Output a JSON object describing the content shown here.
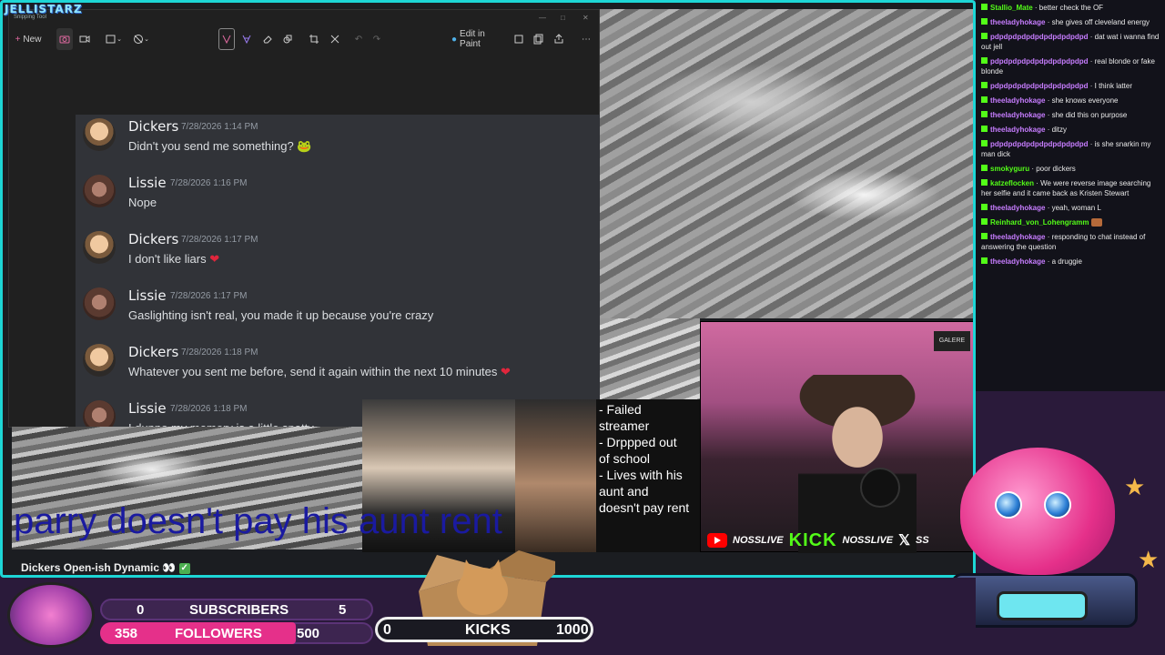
{
  "stream": {
    "logo": "JELLISTARZ",
    "logo_sub": "Snipping Tool",
    "video_title": "Dickers Open-ish Dynamic",
    "video_title_emoji": "👀"
  },
  "snipping_tool": {
    "new_label": "New",
    "edit_label": "Edit in Paint"
  },
  "discord": {
    "messages": [
      {
        "user": "Dickers",
        "time": "7/28/2026 1:14 PM",
        "text": "Didn't you send me something? 🐸"
      },
      {
        "user": "Lissie",
        "time": "7/28/2026 1:16 PM",
        "text": "Nope"
      },
      {
        "user": "Dickers",
        "time": "7/28/2026 1:17 PM",
        "text": "I don't like liars"
      },
      {
        "user": "Lissie",
        "time": "7/28/2026 1:17 PM",
        "text": "Gaslighting isn't real, you made it up because you're crazy"
      },
      {
        "user": "Dickers",
        "time": "7/28/2026 1:18 PM",
        "text": "Whatever you sent me before, send it again within the next 10 minutes"
      },
      {
        "user": "Lissie",
        "time": "7/28/2026 1:18 PM",
        "text": "I dunno my memory is a little spotty"
      }
    ]
  },
  "collage": {
    "caption": "parry doesn't pay his aunt rent",
    "notes": [
      "- Failed",
      "streamer",
      "- Drppped out",
      "of school",
      "- Lives with his",
      "aunt and",
      "doesn't pay rent"
    ]
  },
  "webcam": {
    "sign": "GALERE",
    "youtube_handle": "NOSSLIVE",
    "kick_logo": "KICK",
    "kick_handle": "NOSSLIVE",
    "x_handle": "SS"
  },
  "chat": [
    {
      "user": "Stallio_Mate",
      "color": "#53fc18",
      "text": "better check the OF"
    },
    {
      "user": "theeladyhokage",
      "color": "#c77dff",
      "text": "she gives off cleveland energy"
    },
    {
      "user": "pdpdpdpdpdpdpdpdpdpdpd",
      "color": "#c77dff",
      "text": "dat wat i wanna find out jell"
    },
    {
      "user": "pdpdpdpdpdpdpdpdpdpdpd",
      "color": "#c77dff",
      "text": "real blonde or fake blonde"
    },
    {
      "user": "pdpdpdpdpdpdpdpdpdpdpd",
      "color": "#c77dff",
      "text": "I think latter"
    },
    {
      "user": "theeladyhokage",
      "color": "#c77dff",
      "text": "she knows everyone"
    },
    {
      "user": "theeladyhokage",
      "color": "#c77dff",
      "text": "she did this on purpose"
    },
    {
      "user": "theeladyhokage",
      "color": "#c77dff",
      "text": "ditzy"
    },
    {
      "user": "pdpdpdpdpdpdpdpdpdpdpd",
      "color": "#c77dff",
      "text": "is she snarkin my man dick"
    },
    {
      "user": "smokyguru",
      "color": "#53fc18",
      "text": "poor dickers"
    },
    {
      "user": "katzeflocken",
      "color": "#53fc18",
      "text": "We were reverse image searching her selfie and it came back as Kristen Stewart"
    },
    {
      "user": "theeladyhokage",
      "color": "#c77dff",
      "text": "yeah, woman L"
    },
    {
      "user": "Reinhard_von_Lohengramm",
      "color": "#53fc18",
      "text": ""
    },
    {
      "user": "theeladyhokage",
      "color": "#c77dff",
      "text": "responding to chat instead of answering the question"
    },
    {
      "user": "theeladyhokage",
      "color": "#c77dff",
      "text": "a druggie"
    }
  ],
  "stats": {
    "subscribers": {
      "label": "SUBSCRIBERS",
      "current": "0",
      "goal": "5",
      "progress": 0
    },
    "followers": {
      "label": "FOLLOWERS",
      "current": "358",
      "goal": "500",
      "progress": 0.716
    },
    "kicks": {
      "label": "KICKS",
      "current": "0",
      "goal": "1000",
      "progress": 0
    }
  },
  "colors": {
    "frame_border": "#1dd6d6",
    "discord_bg": "#313338",
    "kick_green": "#53fc18",
    "chat_purple": "#c77dff",
    "followers_pink": "#e5308a",
    "heart_red": "#e0263c",
    "caption_blue": "#1a1aa0"
  }
}
